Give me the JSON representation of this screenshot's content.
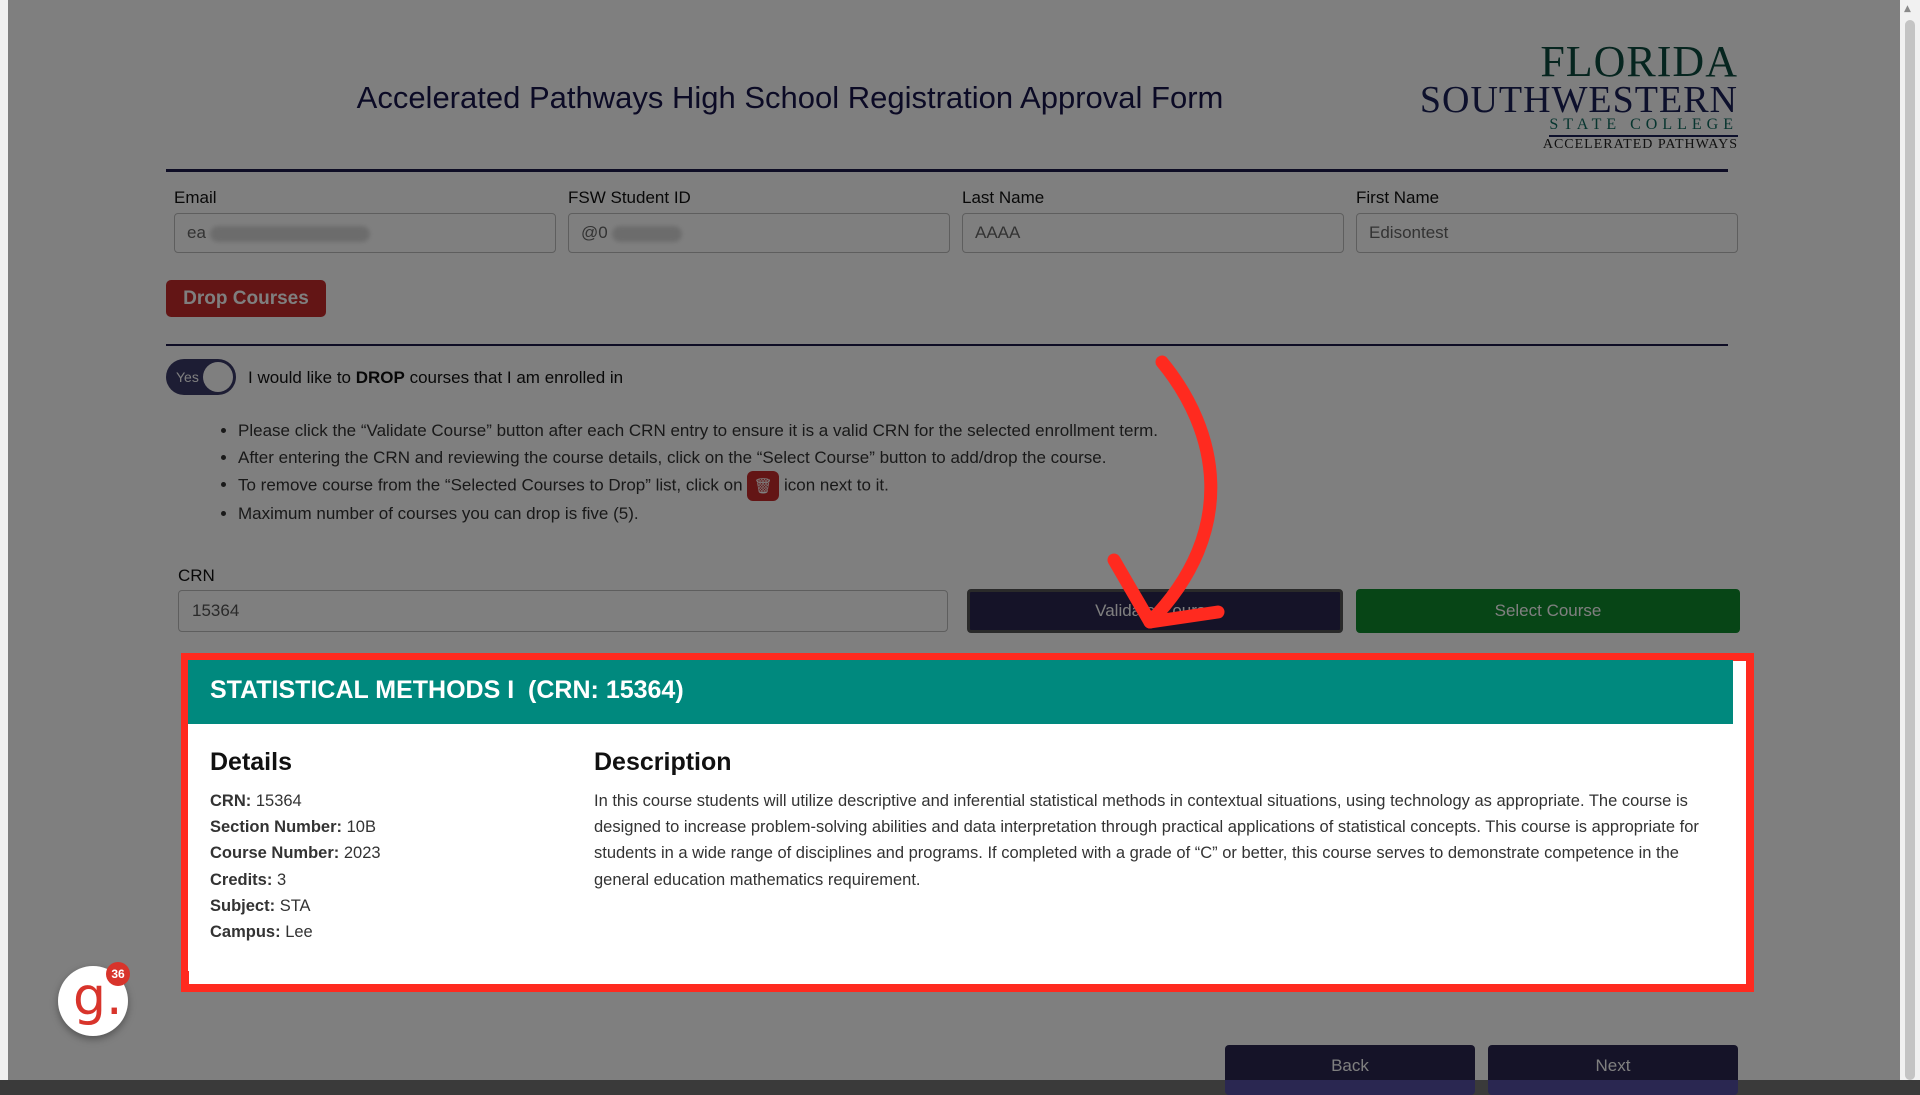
{
  "page_title": "Accelerated Pathways High School Registration Approval Form",
  "logo": {
    "line1": "FLORIDA",
    "line2": "SOUTHWESTERN",
    "line3": "STATE COLLEGE",
    "line4": "ACCELERATED PATHWAYS"
  },
  "fields": {
    "email": {
      "label": "Email",
      "value": "ea"
    },
    "student_id": {
      "label": "FSW Student ID",
      "value": "@0"
    },
    "last_name": {
      "label": "Last Name",
      "value": "AAAA"
    },
    "first_name": {
      "label": "First Name",
      "value": "Edisontest"
    }
  },
  "drop_courses_button": "Drop Courses",
  "toggle": {
    "state_label": "Yes",
    "text_before": "I would like to ",
    "text_bold": "DROP",
    "text_after": " courses that I am enrolled in"
  },
  "instructions": {
    "item1": "Please click the “Validate Course” button after each CRN entry to ensure it is a valid CRN for the selected enrollment term.",
    "item2": "After entering the CRN and reviewing the course details, click on the “Select Course” button to add/drop the course.",
    "item3_before": "To remove course from the “Selected Courses to Drop” list, click on ",
    "item3_after": " icon next to it.",
    "item4": "Maximum number of courses you can drop is five (5)."
  },
  "crn": {
    "label": "CRN",
    "value": "15364"
  },
  "buttons": {
    "validate": "Validate Course",
    "select": "Select Course",
    "back": "Back",
    "next": "Next"
  },
  "course": {
    "title": "STATISTICAL METHODS I  (CRN: 15364)",
    "details_heading": "Details",
    "description_heading": "Description",
    "details": [
      {
        "label": "CRN:",
        "value": "15364"
      },
      {
        "label": "Section Number:",
        "value": "10B"
      },
      {
        "label": "Course Number:",
        "value": "2023"
      },
      {
        "label": "Credits:",
        "value": "3"
      },
      {
        "label": "Subject:",
        "value": "STA"
      },
      {
        "label": "Campus:",
        "value": "Lee"
      }
    ],
    "description": "In this course students will utilize descriptive and inferential statistical methods in contextual situations, using technology as appropriate. The course is designed to increase problem-solving abilities and data interpretation through practical applications of statistical concepts. This course is appropriate for students in a wide range of disciplines and programs. If completed with a grade of “C” or better, this course serves to demonstrate competence in the general education mathematics requirement."
  },
  "badge": {
    "letter": "g.",
    "count": "36"
  },
  "colors": {
    "navy": "#2a2751",
    "teal_header": "#11a899",
    "drop_red": "#c62a2a",
    "select_green": "#0f8a2c",
    "highlight_red": "#ff2a1f"
  },
  "icons": {
    "trash": "trash-icon",
    "arrow": "red-annotation-arrow-icon",
    "scroll_up": "scroll-up-icon"
  }
}
